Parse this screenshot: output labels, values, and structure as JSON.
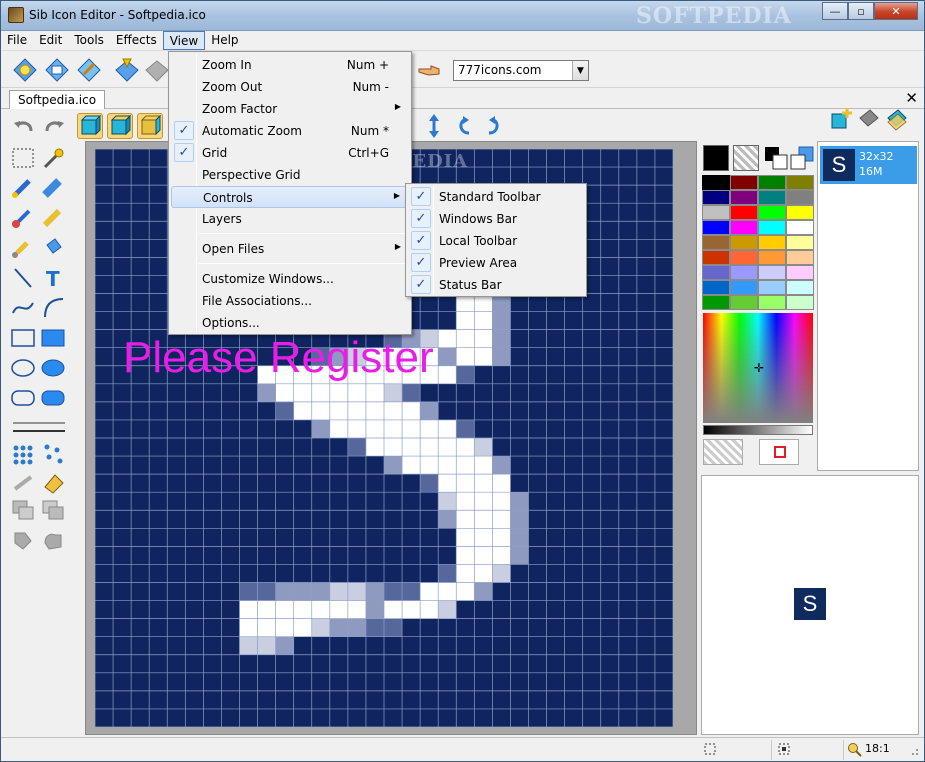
{
  "window": {
    "title": "Sib Icon Editor - Softpedia.ico",
    "watermark": "SOFTPEDIA",
    "buttons": {
      "minimize": "—",
      "maximize": "▫",
      "close": "✕"
    }
  },
  "menubar": [
    "File",
    "Edit",
    "Tools",
    "Effects",
    "View",
    "Help"
  ],
  "toolbar": {
    "icon_source": "777icons.com"
  },
  "document": {
    "tab": "Softpedia.ico",
    "close": "✕"
  },
  "canvas": {
    "overlay_text": "Please Register",
    "watermark": "SOFTPEDIA",
    "grid_size": 32,
    "background_color": "#102560"
  },
  "view_menu": {
    "items": [
      {
        "label": "Zoom In",
        "shortcut": "Num +"
      },
      {
        "label": "Zoom Out",
        "shortcut": "Num -"
      },
      {
        "label": "Zoom Factor",
        "submenu": true
      },
      {
        "label": "Automatic Zoom",
        "shortcut": "Num *",
        "checked": true
      },
      {
        "label": "Grid",
        "shortcut": "Ctrl+G",
        "checked": true
      },
      {
        "label": "Perspective Grid"
      },
      {
        "label": "Controls",
        "submenu": true,
        "highlighted": true
      },
      {
        "label": "Layers"
      },
      {
        "label": "Open Files",
        "submenu": true
      },
      {
        "label": "Customize Windows..."
      },
      {
        "label": "File Associations..."
      },
      {
        "label": "Options..."
      }
    ]
  },
  "controls_menu": {
    "items": [
      {
        "label": "Standard Toolbar",
        "checked": true
      },
      {
        "label": "Windows Bar",
        "checked": true
      },
      {
        "label": "Local Toolbar",
        "checked": true
      },
      {
        "label": "Preview Area",
        "checked": true
      },
      {
        "label": "Status Bar",
        "checked": true
      }
    ]
  },
  "palette": {
    "foreground": "#000000",
    "colors": [
      "#000000",
      "#800000",
      "#008000",
      "#808000",
      "#000080",
      "#800080",
      "#008080",
      "#808080",
      "#c0c0c0",
      "#ff0000",
      "#00ff00",
      "#ffff00",
      "#0000ff",
      "#ff00ff",
      "#00ffff",
      "#ffffff",
      "#996633",
      "#cc9900",
      "#ffcc00",
      "#ffff99",
      "#cc3300",
      "#ff6633",
      "#ff9933",
      "#ffcc99",
      "#6666cc",
      "#9999ff",
      "#ccccff",
      "#ffccff",
      "#0066cc",
      "#3399ff",
      "#99ccff",
      "#ccffff",
      "#009900",
      "#66cc33",
      "#99ff66",
      "#ccffcc"
    ]
  },
  "formats": [
    {
      "glyph": "S",
      "size": "32x32",
      "depth": "16M"
    }
  ],
  "preview": {
    "glyph": "S"
  },
  "status": {
    "zoom": "18:1"
  }
}
